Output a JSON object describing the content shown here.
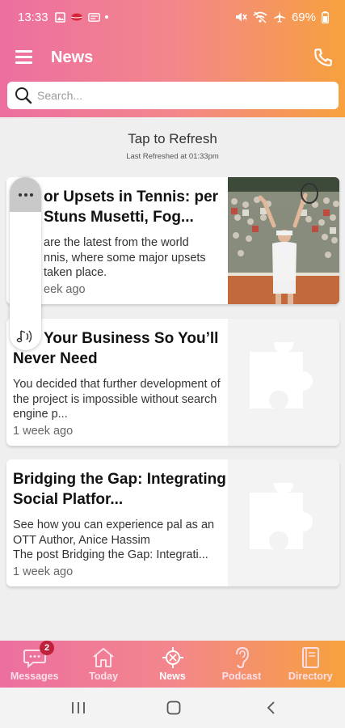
{
  "status": {
    "time": "13:33",
    "battery": "69%"
  },
  "header": {
    "title": "News"
  },
  "search": {
    "placeholder": "Search..."
  },
  "refresh": {
    "title": "Tap to Refresh",
    "last_refreshed": "Last Refreshed at  01:33pm"
  },
  "articles": [
    {
      "title": "or Upsets in Tennis: per Stuns Musetti, Fog...",
      "excerpt": "are the latest from the world\nnnis, where some major upsets\ntaken place.",
      "time": "eek ago"
    },
    {
      "title": "Your Business So You’ll Never Need",
      "excerpt": "You decided that further development of the project is impossible without search engine p...",
      "time": "1 week ago"
    },
    {
      "title": "Bridging the Gap: Integrating Social Platfor...",
      "excerpt": "See how you can experience pal as an OTT Author, Anice Hassim\nThe post Bridging the Gap: Integrati...",
      "time": "1 week ago"
    }
  ],
  "nav": {
    "badge": "2",
    "tabs": [
      {
        "label": "Messages"
      },
      {
        "label": "Today"
      },
      {
        "label": "News"
      },
      {
        "label": "Podcast"
      },
      {
        "label": "Directory"
      }
    ]
  },
  "icons": {
    "menu": "hamburger-icon",
    "phone": "phone-icon",
    "search": "search-icon",
    "more": "more-dots-icon",
    "audio": "audio-icon",
    "placeholder": "puzzle-piece-icon"
  },
  "colors": {
    "gradient_start": "#ec6fa0",
    "gradient_end": "#f6a13e",
    "badge": "#c0213a"
  }
}
